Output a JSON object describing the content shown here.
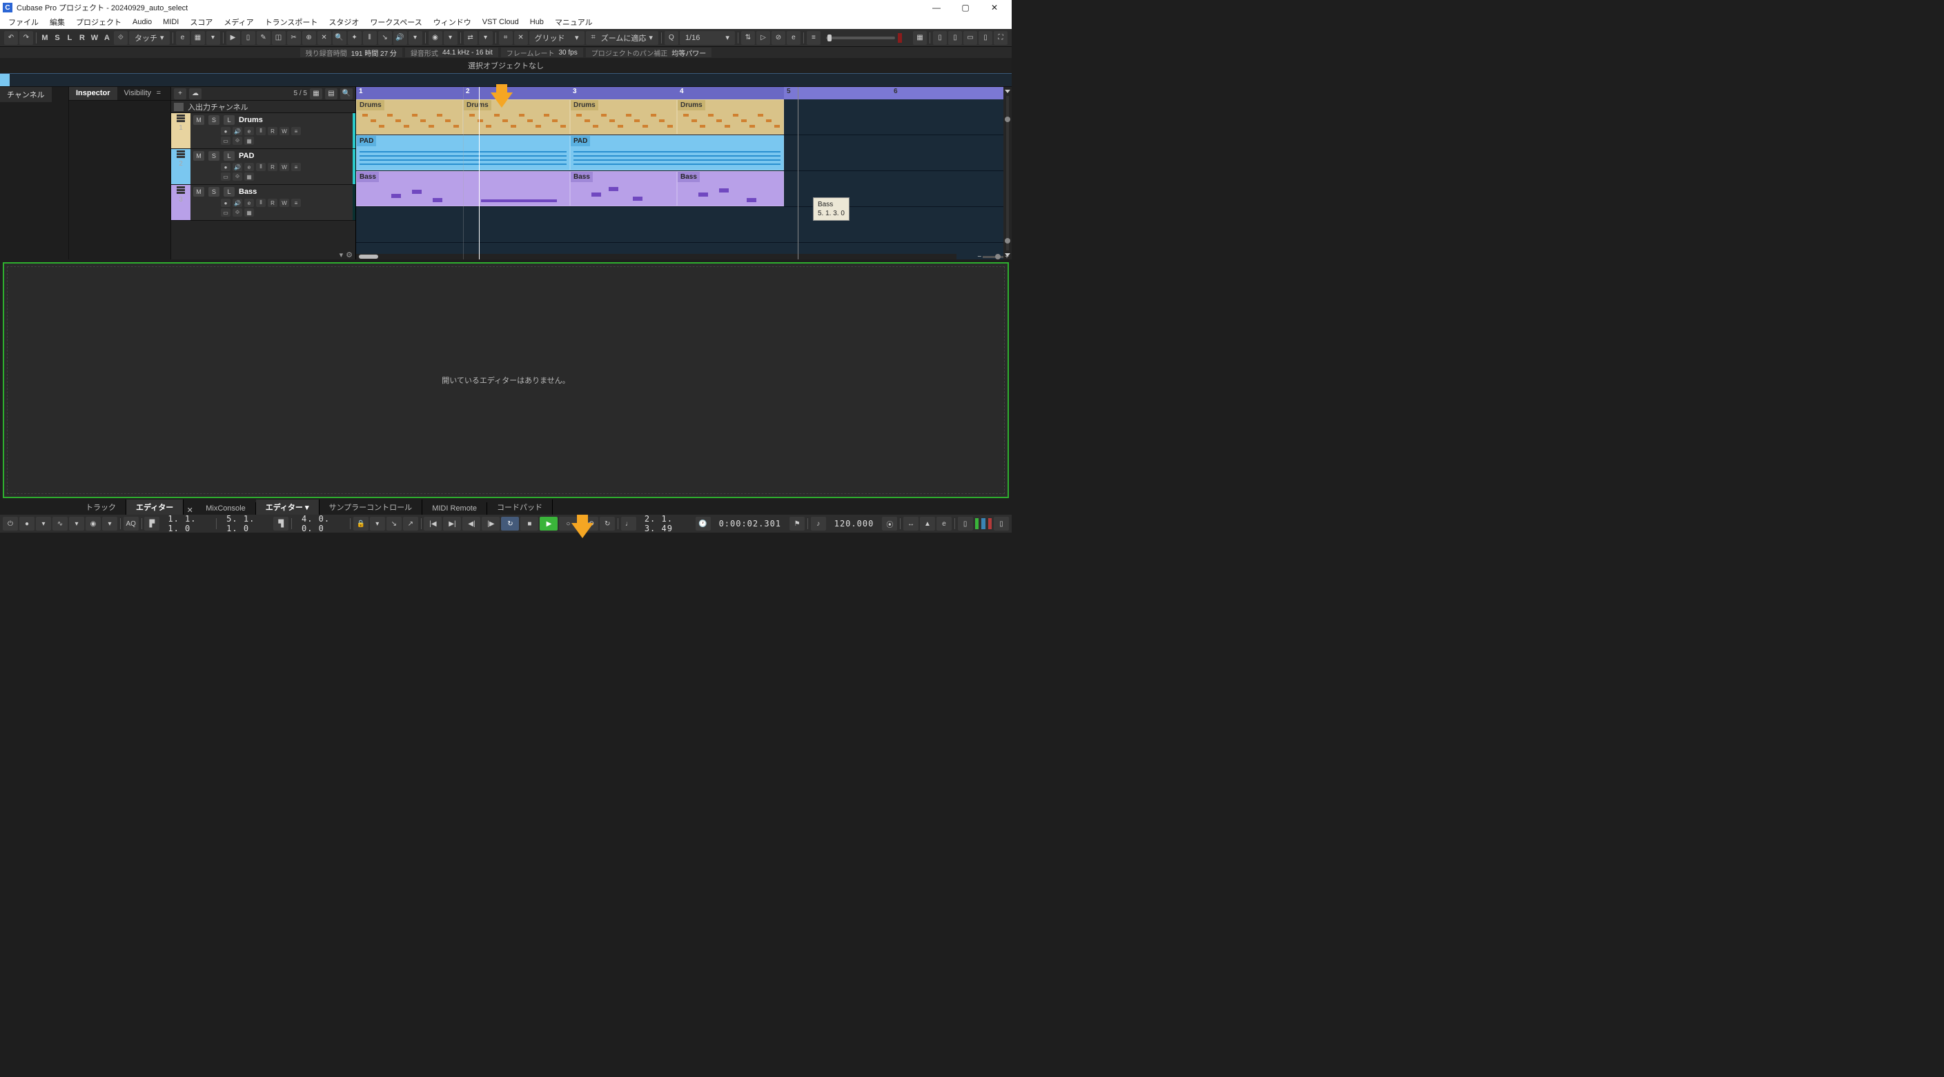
{
  "window": {
    "title": "Cubase Pro プロジェクト - 20240929_auto_select"
  },
  "menu": [
    "ファイル",
    "編集",
    "プロジェクト",
    "Audio",
    "MIDI",
    "スコア",
    "メディア",
    "トランスポート",
    "スタジオ",
    "ワークスペース",
    "ウィンドウ",
    "VST Cloud",
    "Hub",
    "マニュアル"
  ],
  "toolbar": {
    "letters": [
      "M",
      "S",
      "L",
      "R",
      "W",
      "A"
    ],
    "automation_mode": "タッチ",
    "snap_type": "グリッド",
    "adapt_zoom": "ズームに適応",
    "quantize": "1/16"
  },
  "info_strip": {
    "rec_time_label": "残り録音時間",
    "rec_time_value": "191 時間 27 分",
    "rec_fmt_label": "録音形式",
    "rec_fmt_value": "44.1 kHz - 16 bit",
    "frame_label": "フレームレート",
    "frame_value": "30 fps",
    "pan_label": "プロジェクトのパン補正",
    "pan_value": "均等パワー"
  },
  "sel_strip": "選択オブジェクトなし",
  "left_tabs": {
    "channel": "チャンネル",
    "inspector": "Inspector",
    "visibility": "Visibility"
  },
  "tracklist": {
    "header_count": "5 / 5",
    "io_row": "入出力チャンネル",
    "tracks": [
      {
        "num": "1",
        "name": "Drums",
        "buttons": [
          "M",
          "S",
          "L"
        ],
        "row2": [
          "●",
          "🔊",
          "e",
          "⦀",
          "R",
          "W",
          "≡"
        ],
        "type": "drums"
      },
      {
        "num": "2",
        "name": "PAD",
        "buttons": [
          "M",
          "S",
          "L"
        ],
        "row2": [
          "●",
          "🔊",
          "e",
          "⦀",
          "R",
          "W",
          "≡"
        ],
        "type": "pad"
      },
      {
        "num": "3",
        "name": "Bass",
        "buttons": [
          "M",
          "S",
          "L"
        ],
        "row2": [
          "●",
          "🔊",
          "e",
          "⦀",
          "R",
          "W",
          "≡"
        ],
        "type": "bass"
      }
    ]
  },
  "ruler": {
    "bars": [
      "1",
      "2",
      "3",
      "4",
      "5",
      "6"
    ],
    "positions": [
      0,
      155,
      310,
      465,
      620,
      775
    ]
  },
  "parts": {
    "drums": [
      "Drums",
      "Drums",
      "Drums",
      "Drums"
    ],
    "pad": [
      "PAD",
      "PAD"
    ],
    "bass": [
      "Bass",
      "Bass",
      "Bass"
    ]
  },
  "tooltip": {
    "line1": "Bass",
    "line2": "5. 1. 3.  0"
  },
  "editor_zone": {
    "empty_text": "開いているエディターはありません。"
  },
  "lower_tabs": {
    "track": "トラック",
    "editor_left": "エディター",
    "mix": "MixConsole",
    "editor_main": "エディター",
    "sampler": "サンプラーコントロール",
    "midi": "MIDI Remote",
    "chord": "コードパッド"
  },
  "transport": {
    "aq": "AQ",
    "left_locator": "1.  1.  1.   0",
    "right_locator": "5.  1.  1.   0",
    "punch": "4.  0.  0.   0",
    "position_bars": "2.  1.  3.  49",
    "position_time": "0:00:02.301",
    "tempo": "120.000"
  }
}
